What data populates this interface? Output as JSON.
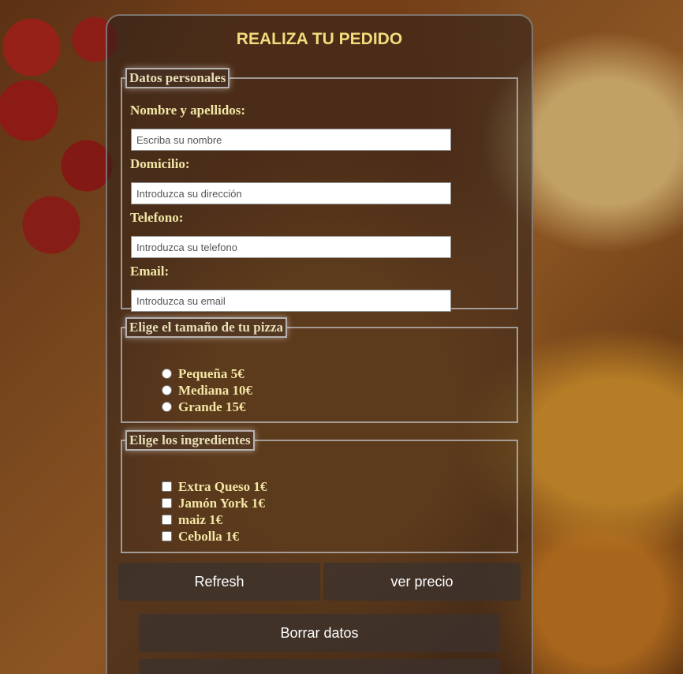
{
  "title": "REALIZA TU PEDIDO",
  "personal": {
    "legend": "Datos personales",
    "name_label": "Nombre y apellidos:",
    "name_placeholder": "Escriba su nombre",
    "address_label": "Domicilio:",
    "address_placeholder": "Introduzca su dirección",
    "phone_label": "Telefono:",
    "phone_placeholder": "Introduzca su telefono",
    "email_label": "Email:",
    "email_placeholder": "Introduzca su email"
  },
  "size": {
    "legend": "Elige el tamaño de tu pizza",
    "options": [
      "Pequeña 5€",
      "Mediana 10€",
      "Grande 15€"
    ]
  },
  "ingredients": {
    "legend": "Elige los ingredientes",
    "options": [
      "Extra Queso 1€",
      "Jamón York 1€",
      "maiz 1€",
      "Cebolla 1€"
    ]
  },
  "buttons": {
    "refresh": "Refresh",
    "price": "ver precio",
    "clear": "Borrar datos"
  }
}
